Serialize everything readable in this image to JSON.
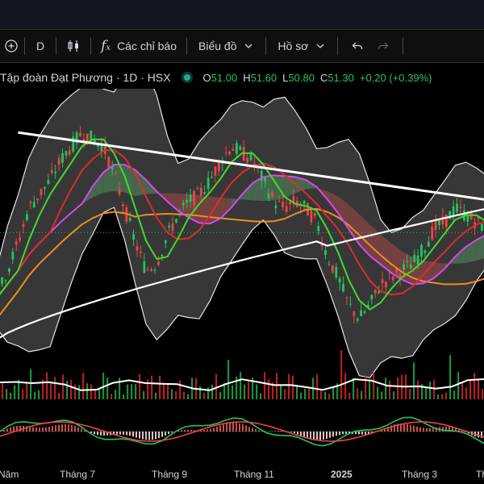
{
  "toolbar": {
    "interval": "D",
    "indicators_label": "Các chỉ báo",
    "chart_type_label": "Biểu đồ",
    "profile_label": "Hồ sơ"
  },
  "legend": {
    "title": "Tập đoàn Đạt Phương · 1D · HSX",
    "o_label": "O",
    "o_value": "51.00",
    "h_label": "H",
    "h_value": "51.60",
    "l_label": "L",
    "l_value": "50.80",
    "c_label": "C",
    "c_value": "51.30",
    "change": "+0.20 (+0.39%)"
  },
  "colors": {
    "up": "#22c55e",
    "down": "#ef4444",
    "ma_short": "#3ddc2e",
    "ma_mid": "#e02b2b",
    "ma_magenta": "#d946ef",
    "ma_orange": "#f08a24",
    "ma_long": "#ffffff",
    "change": "#22c55e",
    "cloud_green": "#1f5f2b",
    "cloud_red": "#7a1616"
  },
  "chart_data": {
    "type": "line",
    "x_tick_labels": [
      "Năm",
      "Tháng 7",
      "Tháng 9",
      "Tháng 11",
      "2025",
      "Tháng 3",
      "Th"
    ],
    "close": [
      40,
      44,
      48,
      53,
      55,
      57,
      60,
      62,
      64,
      63,
      62,
      58,
      53,
      48,
      44,
      45,
      49,
      52,
      54,
      55,
      57,
      60,
      62,
      61,
      60,
      57,
      54,
      53,
      54,
      53,
      51,
      46,
      43,
      39,
      37,
      39,
      42,
      43,
      44,
      45,
      47,
      50,
      51,
      53,
      52,
      51,
      50
    ],
    "trendline": {
      "from": [
        2,
        64
      ],
      "to": [
        47,
        54
      ]
    },
    "support_line": {
      "from": [
        0,
        34
      ],
      "to": [
        47,
        54
      ]
    }
  }
}
